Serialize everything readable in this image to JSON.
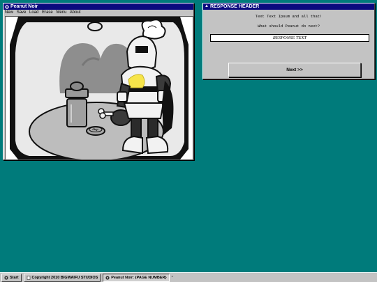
{
  "game_window": {
    "title": "Peanut Noir",
    "menu": [
      "New",
      "Save",
      "Load",
      "Erase",
      "Menu",
      "About"
    ]
  },
  "response_window": {
    "title": "RESPONSE HEADER",
    "body_text": "Text Text Ipsum and all that!",
    "prompt": "What should Peanut do next?",
    "response_value": "RESPONSE TEXT",
    "next_label": "Next >>"
  },
  "taskbar": {
    "start_label": "Start",
    "copyright_label": "Copyright 2010 BIGWAIFU STUDIOS",
    "window_label": "Peanut Noir: {PAGE NUMBER}",
    "tray_label": "*"
  },
  "colors": {
    "desktop": "#007b7b",
    "titlebar": "#0a0a7e",
    "chrome": "#c3c3c3",
    "cheese": "#f7e54a"
  },
  "icons": [
    "window-icon",
    "start-icon",
    "document-icon",
    "window-task-icon"
  ]
}
